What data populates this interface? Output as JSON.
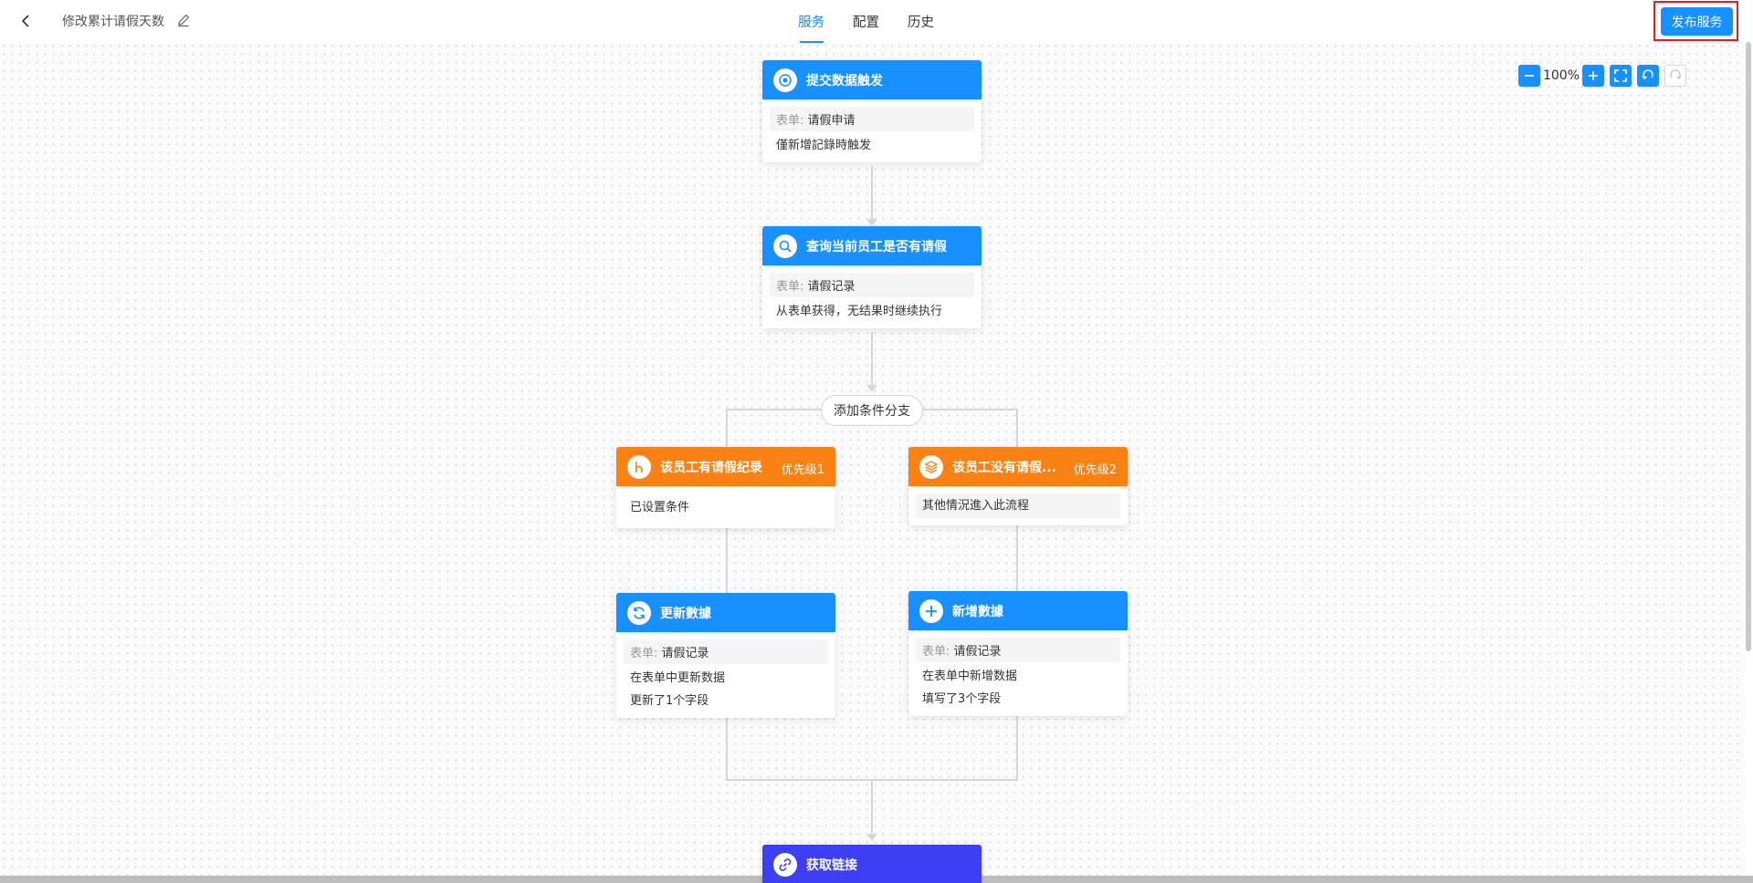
{
  "header": {
    "title": "修改累计请假天数",
    "tabs": [
      {
        "label": "服务",
        "active": true
      },
      {
        "label": "配置",
        "active": false
      },
      {
        "label": "历史",
        "active": false
      }
    ],
    "publish_label": "发布服务"
  },
  "zoom": {
    "level": "100%"
  },
  "nodes": {
    "trigger": {
      "title": "提交数据触发",
      "form_label": "表单:",
      "form_value": "请假申请",
      "desc": "僅新增記錄時触发",
      "icon": "target-icon"
    },
    "query": {
      "title": "查询当前员工是否有请假",
      "form_label": "表单:",
      "form_value": "请假记录",
      "desc": "从表单获得，无结果时继续执行",
      "icon": "search-icon"
    },
    "branch_add": {
      "label": "添加条件分支"
    },
    "cond_yes": {
      "title": "该员工有请假纪录",
      "priority": "优先级1",
      "desc": "已设置条件",
      "icon": "branch-icon"
    },
    "cond_no": {
      "title": "该员工没有请假...",
      "priority": "优先级2",
      "desc": "其他情況進入此流程",
      "icon": "layers-icon"
    },
    "update": {
      "title": "更新數據",
      "form_label": "表单:",
      "form_value": "请假记录",
      "desc1": "在表单中更新数据",
      "desc2": "更新了1个字段",
      "icon": "refresh-icon"
    },
    "create": {
      "title": "新增數據",
      "form_label": "表单:",
      "form_value": "请假记录",
      "desc1": "在表单中新增数据",
      "desc2": "填写了3个字段",
      "icon": "plus-icon"
    },
    "link": {
      "title": "获取链接",
      "icon": "link-icon"
    }
  },
  "colors": {
    "primary": "#1890ff",
    "condition": "#fa8214",
    "link_node": "#3d3ff5",
    "highlight_border": "#e02020"
  }
}
